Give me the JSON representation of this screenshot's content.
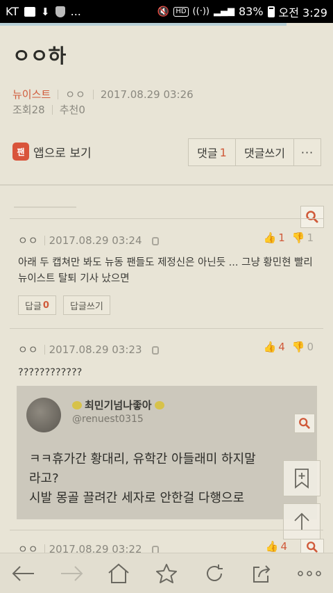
{
  "status_bar": {
    "carrier": "KT",
    "more": "...",
    "battery": "83%",
    "time": "오전 3:29"
  },
  "page_progress": 0.86,
  "post": {
    "title": "ㅇㅇ하",
    "board": "뉴이스트",
    "author": "ㅇㅇ",
    "datetime": "2017.08.29 03:26",
    "views_label": "조회",
    "views": "28",
    "recommend_label": "추천",
    "recommend": "0"
  },
  "actions": {
    "app_badge": "팬",
    "app_view": "앱으로 보기",
    "comments_label": "댓글",
    "comments_count": "1",
    "write_comment": "댓글쓰기",
    "more": "···"
  },
  "comments": [
    {
      "nick": "ㅇㅇ",
      "datetime": "2017.08.29 03:24",
      "up": "1",
      "down": "1",
      "text": "아래 두 캡쳐만 봐도 뉴동 팬들도 제정신은 아닌듯 ... 그냥 황민현 빨리 뉴이스트 탈퇴 기사 났으면",
      "reply_label": "답글",
      "reply_count": "0",
      "reply_write": "답글쓰기"
    },
    {
      "nick": "ㅇㅇ",
      "datetime": "2017.08.29 03:23",
      "up": "4",
      "down": "0",
      "text": "????????????",
      "embed": {
        "username": "최민기넘나좋아",
        "handle": "@renuest0315",
        "tweet_line1": "ㅋㅋ휴가간 황대리, 유학간 아들래미 하지말",
        "tweet_line2": "라고?",
        "tweet_line3": "시발 몽골 끌려간 세자로 안한걸 다행으로"
      }
    },
    {
      "nick": "ㅇㅇ",
      "datetime": "2017.08.29 03:22",
      "up": "4"
    }
  ],
  "colors": {
    "accent": "#d05a3a",
    "background": "#e8e4d6",
    "status_bar": "#000000"
  },
  "icons": {
    "search": "search-icon",
    "bookmark": "bookmark-add-icon",
    "scroll_top": "arrow-up-icon",
    "nav": [
      "back-arrow-icon",
      "forward-arrow-icon",
      "home-icon",
      "star-icon",
      "refresh-icon",
      "share-icon",
      "more-dots-icon"
    ]
  }
}
